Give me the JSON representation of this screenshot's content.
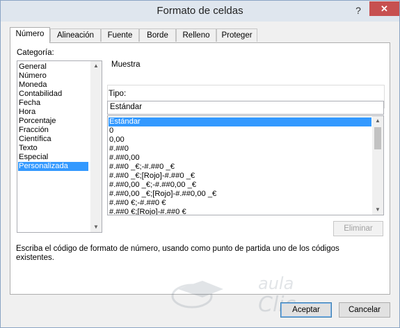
{
  "window": {
    "title": "Formato de celdas",
    "help_glyph": "?",
    "close_glyph": "✕"
  },
  "tabs": [
    {
      "label": "Número",
      "active": true
    },
    {
      "label": "Alineación",
      "active": false
    },
    {
      "label": "Fuente",
      "active": false
    },
    {
      "label": "Borde",
      "active": false
    },
    {
      "label": "Relleno",
      "active": false
    },
    {
      "label": "Proteger",
      "active": false
    }
  ],
  "category": {
    "label": "Categoría:",
    "items": [
      "General",
      "Número",
      "Moneda",
      "Contabilidad",
      "Fecha",
      "Hora",
      "Porcentaje",
      "Fracción",
      "Científica",
      "Texto",
      "Especial",
      "Personalizada"
    ],
    "selected": "Personalizada"
  },
  "sample": {
    "label": "Muestra",
    "value": ""
  },
  "type": {
    "label": "Tipo:",
    "value": "Estándar",
    "items": [
      "Estándar",
      "0",
      "0,00",
      "#.##0",
      "#.##0,00",
      "#.##0 _€;-#.##0 _€",
      "#.##0 _€;[Rojo]-#.##0 _€",
      "#.##0,00 _€;-#.##0,00 _€",
      "#.##0,00 _€;[Rojo]-#.##0,00 _€",
      "#.##0 €;-#.##0 €",
      "#.##0 €;[Rojo]-#.##0 €"
    ],
    "selected": "Estándar"
  },
  "delete_button": "Eliminar",
  "description": "Escriba el código de formato de número, usando como punto de partida uno de los códigos existentes.",
  "watermark": {
    "line1": "aula",
    "line2": "Clic"
  },
  "ok_button": "Aceptar",
  "cancel_button": "Cancelar",
  "colors": {
    "selection": "#3399ff",
    "close": "#c75050",
    "titlebar": "#dfe6ee"
  }
}
